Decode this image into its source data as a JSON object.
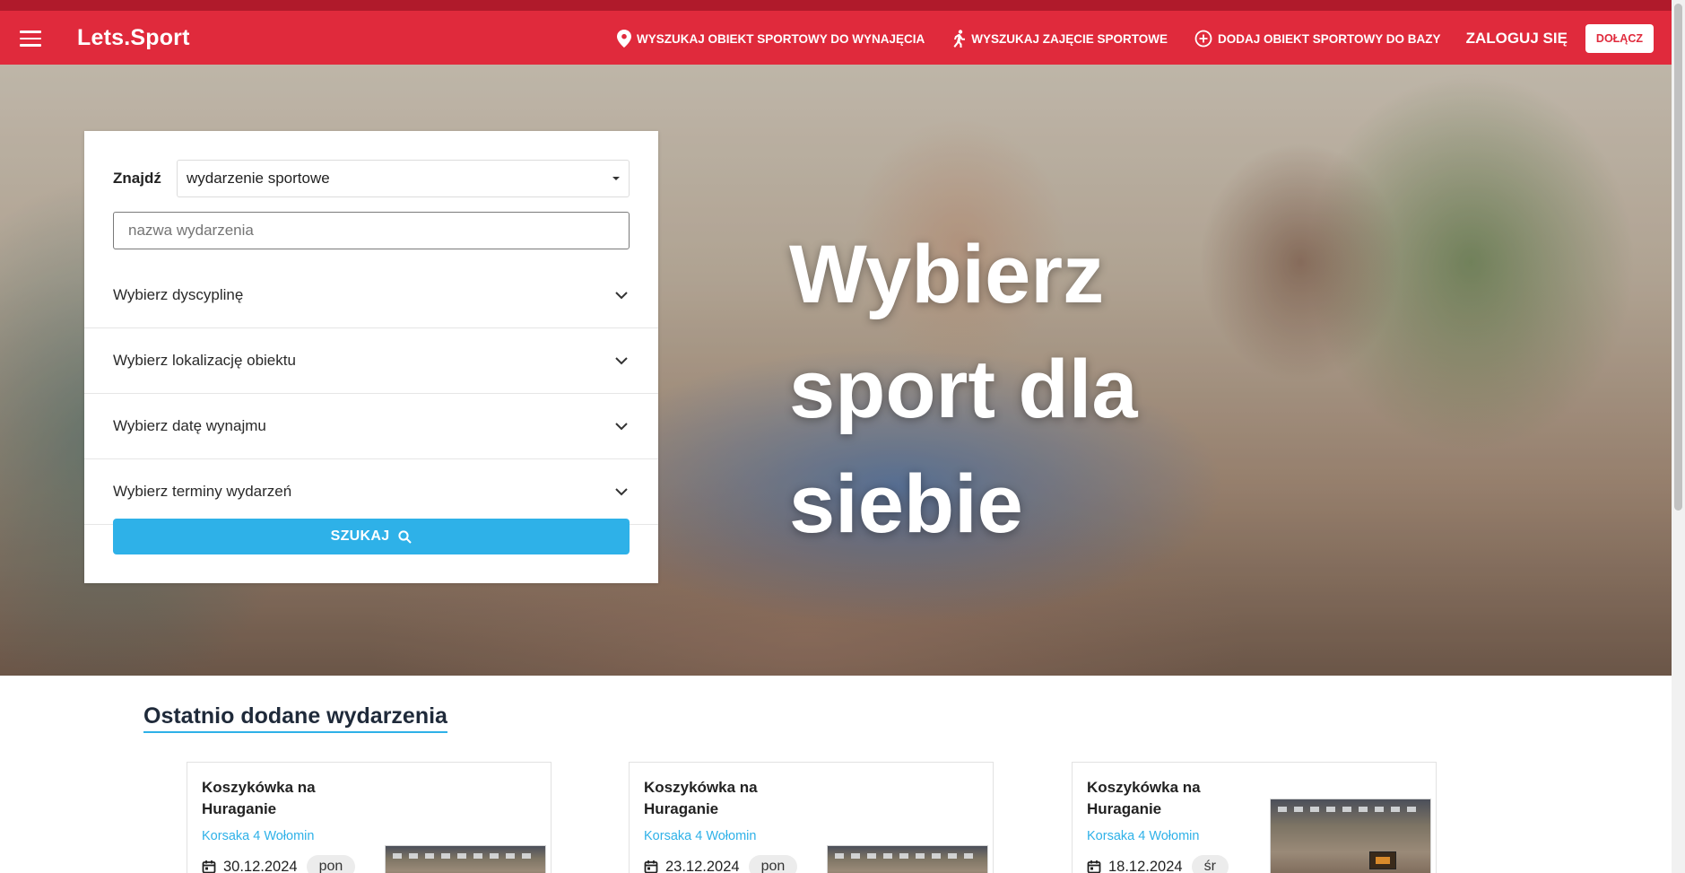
{
  "navbar": {
    "brand": "Lets.Sport",
    "links": [
      {
        "label": "WYSZUKAJ OBIEKT SPORTOWY DO WYNAJĘCIA",
        "icon": "location-pin-icon"
      },
      {
        "label": "WYSZUKAJ ZAJĘCIE SPORTOWE",
        "icon": "runner-icon"
      },
      {
        "label": "DODAJ OBIEKT SPORTOWY DO BAZY",
        "icon": "plus-circle-icon"
      }
    ],
    "login_label": "ZALOGUJ SIĘ",
    "join_label": "DOŁĄCZ"
  },
  "hero": {
    "title": "Wybierz sport dla siebie"
  },
  "search": {
    "find_label": "Znajdź",
    "type_selected": "wydarzenie sportowe",
    "name_placeholder": "nazwa wydarzenia",
    "accordions": [
      "Wybierz dyscyplinę",
      "Wybierz lokalizację obiektu",
      "Wybierz datę wynajmu",
      "Wybierz terminy wydarzeń"
    ],
    "submit_label": "SZUKAJ"
  },
  "recent": {
    "title": "Ostatnio dodane wydarzenia",
    "cards": [
      {
        "title": "Koszykówka na Huraganie",
        "location": "Korsaka 4 Wołomin",
        "date": "30.12.2024",
        "day": "pon"
      },
      {
        "title": "Koszykówka na Huraganie",
        "location": "Korsaka 4 Wołomin",
        "date": "23.12.2024",
        "day": "pon"
      },
      {
        "title": "Koszykówka na Huraganie",
        "location": "Korsaka 4 Wołomin",
        "date": "18.12.2024",
        "day": "śr"
      }
    ]
  },
  "colors": {
    "brand_red": "#e02a3c",
    "accent_blue": "#2eb1e8"
  }
}
